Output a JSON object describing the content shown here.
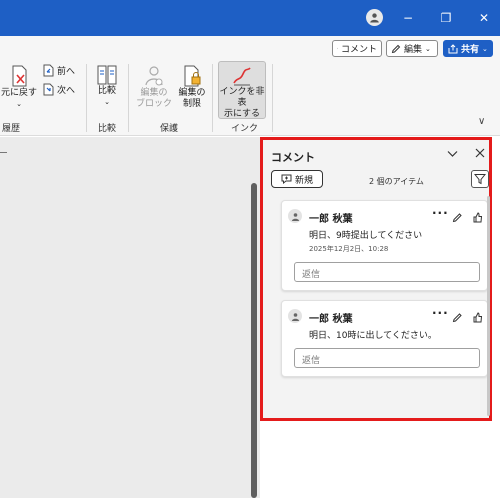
{
  "titlebar": {
    "icons": [
      "account-icon",
      "minimize-icon",
      "restore-icon",
      "close-icon"
    ],
    "minimize_glyph": "−",
    "restore_glyph": "❐",
    "close_glyph": "✕"
  },
  "command_bar": {
    "comment_label": "コメント",
    "edit_label": "編集",
    "share_label": "共有"
  },
  "ribbon": {
    "undo_label_1": "元に戻す",
    "undo_label_2": "",
    "prev_label": "前へ",
    "next_label": "次へ",
    "history_group": "履歴",
    "compare_label": "比較",
    "compare_group": "比較",
    "block_label_1": "編集の",
    "block_label_2": "ブロック",
    "restrict_label_1": "編集の",
    "restrict_label_2": "制限",
    "protect_group": "保護",
    "ink_label_1": "インクを非表",
    "ink_label_2": "示にする",
    "ink_group": "インク",
    "collapse_glyph": "∨"
  },
  "comments_pane": {
    "title": "コメント",
    "new_label": "新規",
    "count_label": "2 個のアイテム",
    "comments": [
      {
        "author": "一郎 秋葉",
        "text": "明日、9時提出してください",
        "date": "2025年12月2日、10:28",
        "reply_placeholder": "返信"
      },
      {
        "author": "一郎 秋葉",
        "text": "明日、10時に出してください。",
        "date": "",
        "reply_placeholder": "返信"
      }
    ]
  },
  "colors": {
    "title_bar": "#1e5fc5",
    "highlight_border": "#e41b1b",
    "ribbon_bg": "#f6f6f6",
    "document_bg": "#ebebeb"
  }
}
